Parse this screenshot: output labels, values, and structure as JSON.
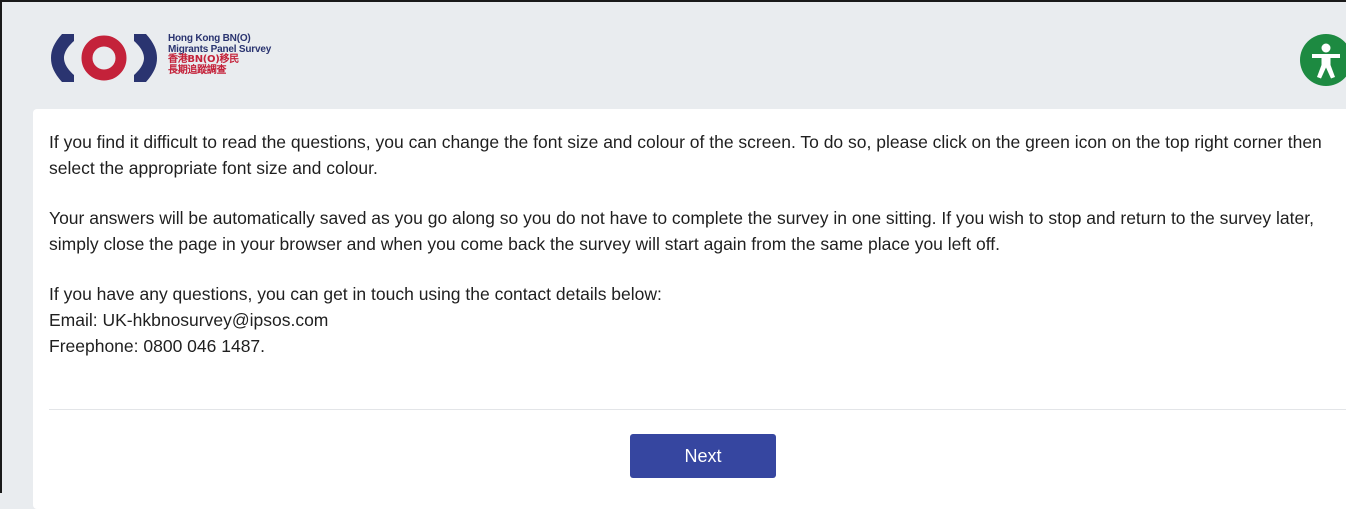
{
  "header": {
    "logo": {
      "mark_icon": "bno-brackets-logo-icon",
      "line1_en": "Hong Kong BN(O)",
      "line2_en": "Migrants Panel Survey",
      "line3_zh": "香港BN(O)移民",
      "line4_zh": "長期追蹤調查"
    },
    "accessibility_icon": "accessibility-person-icon"
  },
  "intro": {
    "para1": "If you find it difficult to read the questions, you can change the font size and colour of the screen. To do so, please click on the green icon on the top right corner then select the appropriate font size and colour.",
    "para2": "Your answers will be automatically saved as you go along so you do not have to complete the survey in one sitting. If you wish to stop and return to the survey later, simply close the page in your browser and when you come back the survey will start again from the same place you left off.",
    "contact_intro": "If you have any questions, you can get in touch using the contact details below:",
    "email": "Email: UK-hkbnosurvey@ipsos.com",
    "phone": "Freephone: 0800 046 1487."
  },
  "buttons": {
    "next_label": "Next"
  },
  "colors": {
    "page_background": "#e9ecef",
    "logo_navy": "#2a3470",
    "logo_red": "#c4223a",
    "accessibility_green": "#1d8a41",
    "next_button": "#3646a0",
    "body_text": "#1f1f1f"
  }
}
